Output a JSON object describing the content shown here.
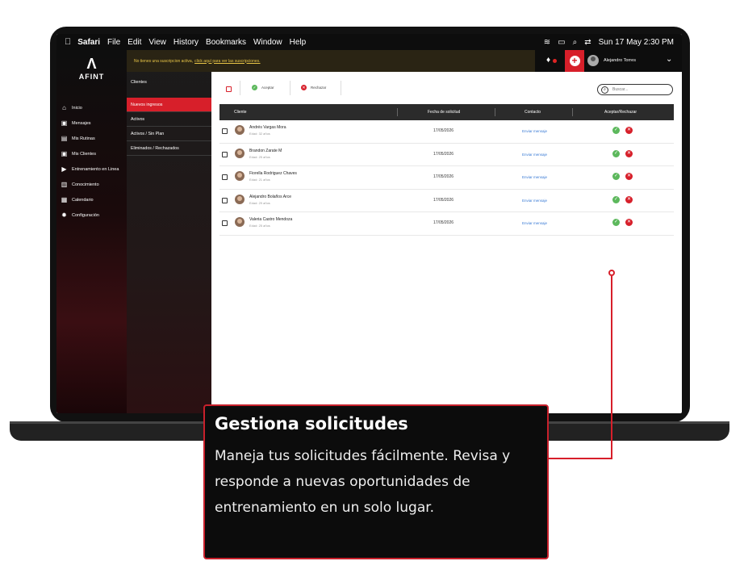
{
  "menubar": {
    "apple": "",
    "app": "Safari",
    "items": [
      "File",
      "Edit",
      "View",
      "History",
      "Bookmarks",
      "Window",
      "Help"
    ],
    "clock": "Sun 17 May 2:30 PM"
  },
  "brand": {
    "mark": "Λ",
    "name": "AFINT"
  },
  "nav": [
    {
      "label": "Inicio",
      "icon": "home-icon",
      "glyph": "⌂"
    },
    {
      "label": "Mensajes",
      "icon": "chat-icon",
      "glyph": "▣"
    },
    {
      "label": "Mis Rutinas",
      "icon": "clipboard-icon",
      "glyph": "▤"
    },
    {
      "label": "Mis Clientes",
      "icon": "user-card-icon",
      "glyph": "▣"
    },
    {
      "label": "Entrenamiento en Linea",
      "icon": "video-icon",
      "glyph": "▶"
    },
    {
      "label": "Conocimiento",
      "icon": "book-icon",
      "glyph": "▥"
    },
    {
      "label": "Calendario",
      "icon": "calendar-icon",
      "glyph": "▦"
    },
    {
      "label": "Configuración",
      "icon": "gear-icon",
      "glyph": "✹"
    }
  ],
  "banner": {
    "text": "No tienes una suscripcion activa,",
    "link": "click aquí para ver las suscripciones."
  },
  "subpanel": {
    "title": "Clientes",
    "items": [
      "Nuevos ingresos",
      "Activos",
      "Activos / Sin Plan",
      "Eliminados / Rechazados"
    ]
  },
  "user": {
    "name": "Alejandro Torres"
  },
  "toolbar": {
    "accept": "Aceptar",
    "reject": "Rechazar",
    "search_placeholder": "Buscar..."
  },
  "table": {
    "headers": [
      "Cliente",
      "Fecha de solicitud",
      "Contacto",
      "Aceptar/Rechazar"
    ],
    "rows": [
      {
        "name": "Andrés Vargas Mora",
        "age": "Edad: 32 años",
        "date": "17/05/2026",
        "contact": "Enviar mensaje"
      },
      {
        "name": "Brandon Zarate M",
        "age": "Edad: 25 años",
        "date": "17/05/2026",
        "contact": "Enviar mensaje"
      },
      {
        "name": "Fiorella Rodriguez Chaves",
        "age": "Edad: 21 años",
        "date": "17/05/2026",
        "contact": "Enviar mensaje"
      },
      {
        "name": "Alejandro Bolaños Arce",
        "age": "Edad: 29 años",
        "date": "17/05/2026",
        "contact": "Enviar mensaje"
      },
      {
        "name": "Valeria Castro Mendoza",
        "age": "Edad: 25 años",
        "date": "17/05/2026",
        "contact": "Enviar mensaje"
      }
    ]
  },
  "callout": {
    "title": "Gestiona solicitudes",
    "body": "Maneja tus solicitudes fácilmente. Revisa y responde a nuevas oportunidades de entrenamiento en un solo lugar."
  },
  "colors": {
    "accent": "#d71f2a",
    "banner_text": "#e8c547"
  }
}
